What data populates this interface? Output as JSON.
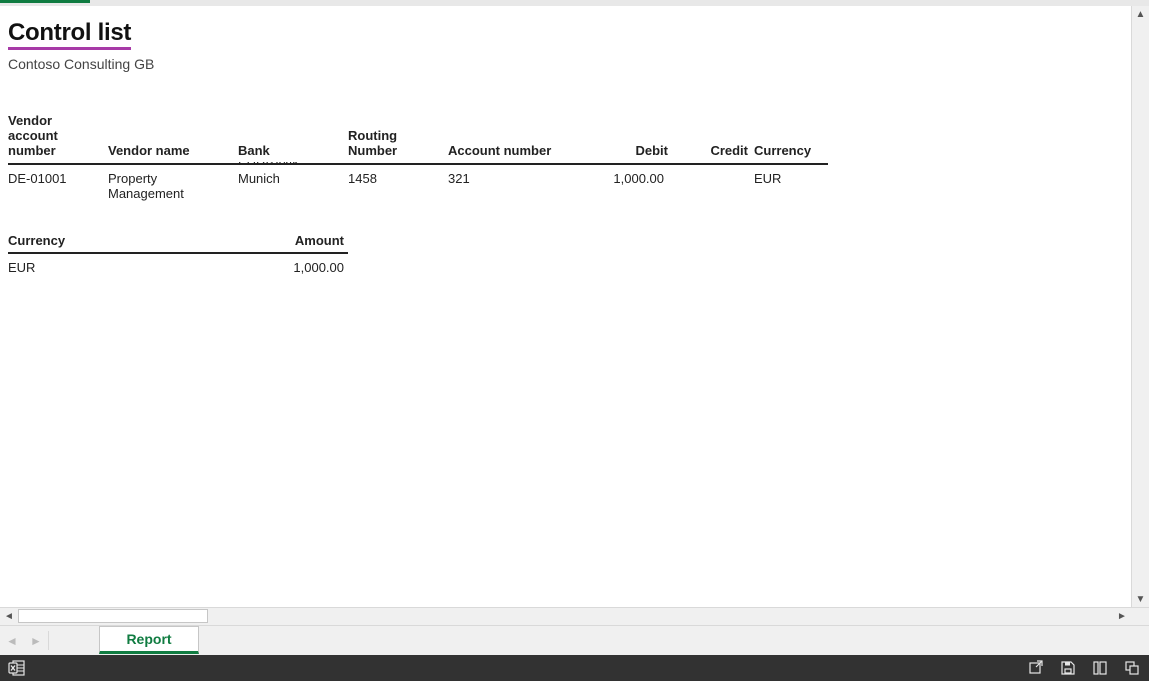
{
  "report": {
    "title": "Control list",
    "company": "Contoso Consulting GB"
  },
  "main_table": {
    "headers": {
      "vendor_account_number": "Vendor account number",
      "vendor_name": "Vendor name",
      "bank": "Bank",
      "routing_number": "Routing Number",
      "account_number": "Account number",
      "debit": "Debit",
      "credit": "Credit",
      "currency": "Currency"
    },
    "rows": [
      {
        "vendor_account_number": "DE-01001",
        "vendor_name": "Property Management",
        "bank": "Munich",
        "bank_cutoff": "EURBANK",
        "routing_number": "1458",
        "account_number": "321",
        "debit": "1,000.00",
        "credit": "",
        "currency": "EUR"
      }
    ]
  },
  "summary_table": {
    "headers": {
      "currency": "Currency",
      "amount": "Amount"
    },
    "rows": [
      {
        "currency": "EUR",
        "amount": "1,000.00"
      }
    ]
  },
  "tabs": {
    "active": "Report"
  },
  "icons": {
    "excel": "excel-icon",
    "share": "share-icon",
    "save": "save-icon",
    "layout": "page-layout-icon",
    "fullscreen": "fullscreen-icon"
  }
}
